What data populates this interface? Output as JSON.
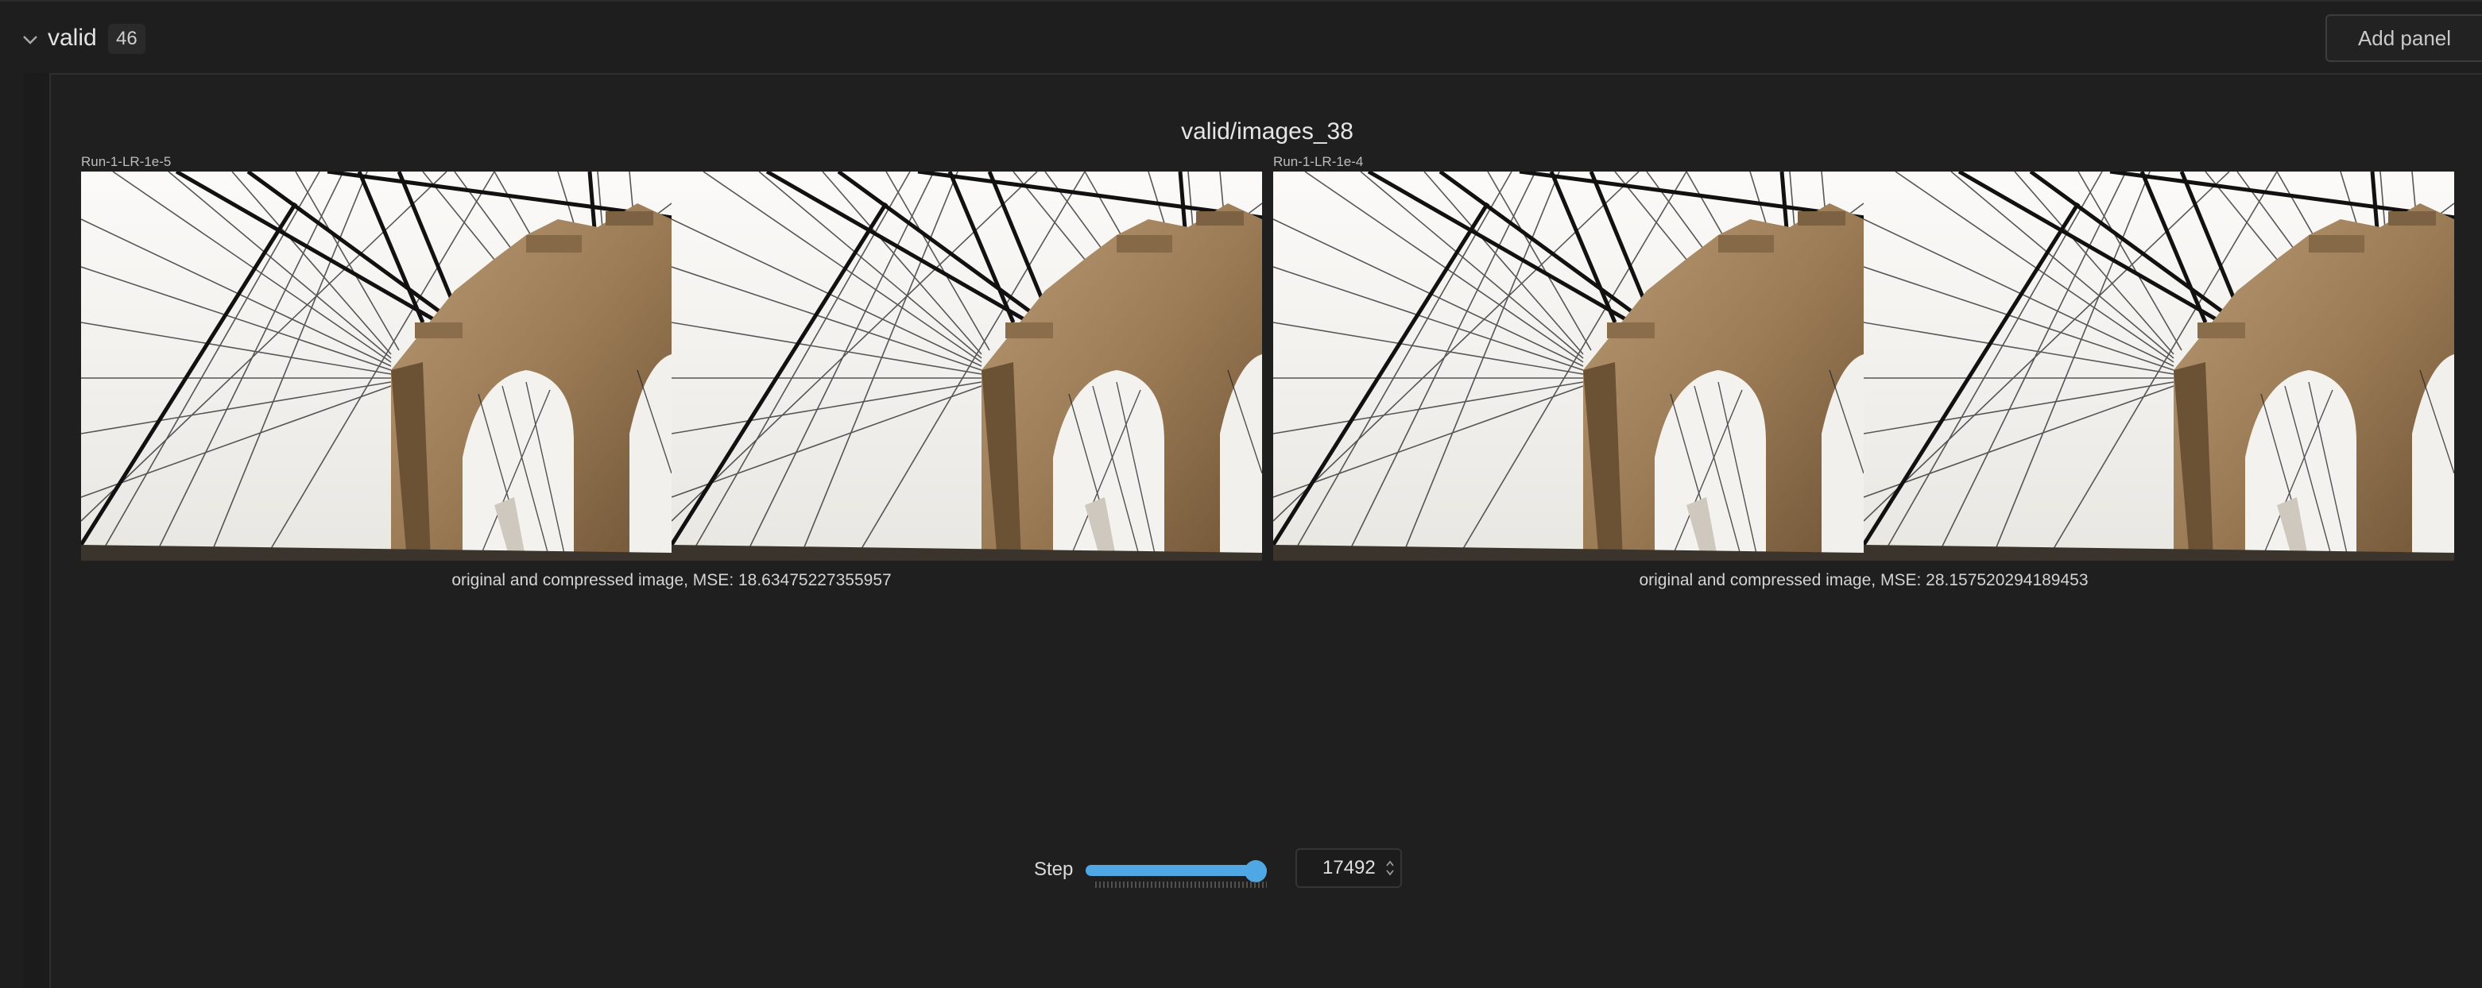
{
  "section": {
    "title": "valid",
    "count": "46",
    "add_panel_label": "Add panel"
  },
  "panel": {
    "title": "valid/images_38",
    "runs": [
      {
        "name": "Run-1-LR-1e-5",
        "caption": "original and compressed image, MSE: 18.63475227355957"
      },
      {
        "name": "Run-1-LR-1e-4",
        "caption": "original and compressed image, MSE: 28.157520294189453"
      }
    ]
  },
  "step": {
    "label": "Step",
    "value": "17492",
    "slider_fraction": 1.0
  },
  "colors": {
    "background": "#1e1e1e",
    "accent": "#4fa8e3",
    "text": "#d6d6d6"
  },
  "icons": {
    "collapse": "chevron-down-icon",
    "spinner": "up-down-arrows-icon"
  }
}
